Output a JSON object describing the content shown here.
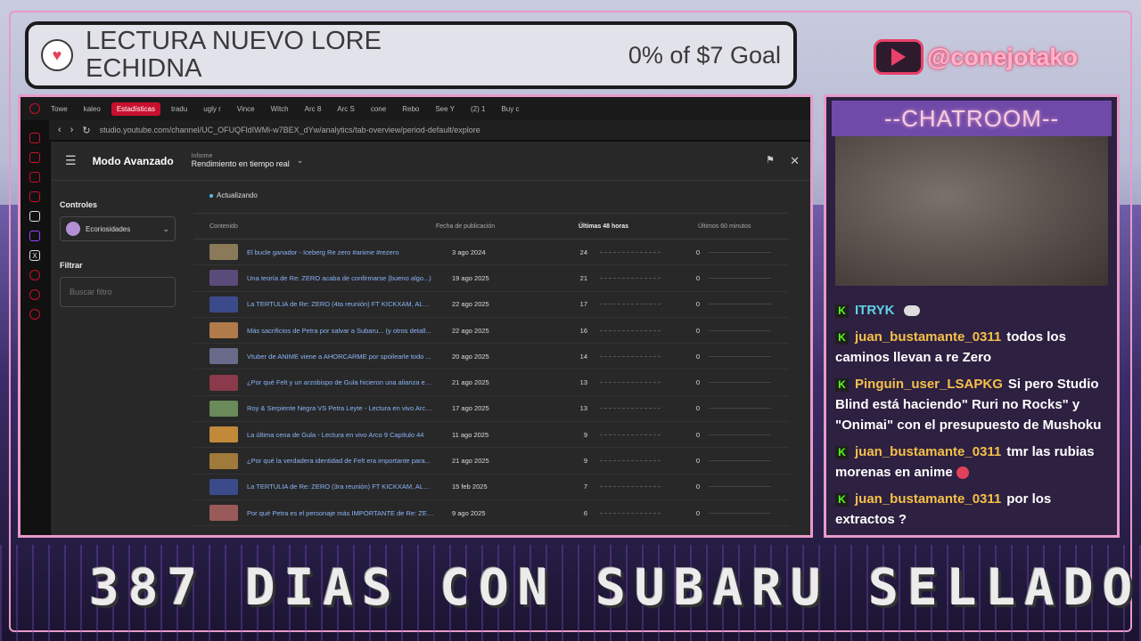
{
  "goal": {
    "title_line1": "LECTURA NUEVO LORE",
    "title_line2": "ECHIDNA",
    "progress_text": "0% of $7 Goal",
    "progress_fraction": 0
  },
  "social": {
    "youtube_handle": "@conejotako"
  },
  "browser": {
    "tabs": [
      "Towe",
      "kaleo",
      "Estadísticas",
      "tradu",
      "ugly r",
      "Vince",
      "Witch",
      "Arc 8",
      "Arc S",
      "cone",
      "Rebo",
      "See Y",
      "(2) 1",
      "Buy c"
    ],
    "active_tab_index": 2,
    "url": "studio.youtube.com/channel/UC_OFUQFldIWMi-w7BEX_dYw/analytics/tab-overview/period-default/explore"
  },
  "studio": {
    "mode_title": "Modo Avanzado",
    "report_label": "Informe",
    "report_value": "Rendimiento en tiempo real",
    "status": "Actualizando",
    "controls_heading": "Controles",
    "channel_name": "Ecoriosidades",
    "filter_heading": "Filtrar",
    "filter_placeholder": "Buscar filtro",
    "columns": {
      "content": "Contenido",
      "published": "Fecha de publicación",
      "last48": "Últimas 48 horas",
      "last60": "Últimos 60 minutos"
    },
    "rows": [
      {
        "title": "El bucle ganador - Iceberg Re zero #anime #rezero",
        "date": "3 ago 2024",
        "h48": "24",
        "m60": "0",
        "thumb": "#8a7a5a"
      },
      {
        "title": "Una teoría de Re: ZERO acaba de confirmarse (bueno algo...)",
        "date": "19 ago 2025",
        "h48": "21",
        "m60": "0",
        "thumb": "#5b4b7a"
      },
      {
        "title": "La TERTULIA de Re: ZERO (4ta reunión) FT KICKXAM, ALAN...",
        "date": "22 ago 2025",
        "h48": "17",
        "m60": "0",
        "thumb": "#3a4a8a"
      },
      {
        "title": "Más sacrificios de Petra por salvar a Subaru... (y otros detall...",
        "date": "22 ago 2025",
        "h48": "16",
        "m60": "0",
        "thumb": "#b07a4a"
      },
      {
        "title": "Vtuber de ANIME viene a AHORCARME por spoilearle todo ...",
        "date": "20 ago 2025",
        "h48": "14",
        "m60": "0",
        "thumb": "#6a6a8a"
      },
      {
        "title": "¿Por qué Felt y un arzobispo de Gula hicieron una alianza en...",
        "date": "21 ago 2025",
        "h48": "13",
        "m60": "0",
        "thumb": "#8a3a4a"
      },
      {
        "title": "Roy & Serpiente Negra VS Petra Leyte - Lectura en vivo Arco ...",
        "date": "17 ago 2025",
        "h48": "13",
        "m60": "0",
        "thumb": "#6a8a5a"
      },
      {
        "title": "La última cena de Gula - Lectura en vivo Arco 9 Capítulo 44",
        "date": "11 ago 2025",
        "h48": "9",
        "m60": "0",
        "thumb": "#c08a3a"
      },
      {
        "title": "¿Por qué la verdadera identidad de Felt era importante para...",
        "date": "21 ago 2025",
        "h48": "9",
        "m60": "0",
        "thumb": "#a07a3a"
      },
      {
        "title": "La TERTULIA de Re: ZERO (3ra reunión) FT KICKXAM, ALAN...",
        "date": "15 feb 2025",
        "h48": "7",
        "m60": "0",
        "thumb": "#3a4a8a"
      },
      {
        "title": "Por qué Petra es el personaje más IMPORTANTE de Re: ZER...",
        "date": "9 ago 2025",
        "h48": "6",
        "m60": "0",
        "thumb": "#9a5a5a"
      }
    ]
  },
  "chat": {
    "title": "--CHATROOM--",
    "messages": [
      {
        "user": "ITRYK",
        "text": "",
        "user_color": "#5fd3e6"
      },
      {
        "user": "juan_bustamante_0311",
        "text": "todos los caminos llevan a re Zero",
        "user_color": "#f5c04a"
      },
      {
        "user": "Pinguin_user_LSAPKG",
        "text": "Si pero Studio Blind está haciendo\" Ruri no Rocks\" y \"Onimai\" con el presupuesto de Mushoku",
        "user_color": "#f5c04a"
      },
      {
        "user": "juan_bustamante_0311",
        "text": "tmr las rubias morenas en anime",
        "user_color": "#f5c04a"
      },
      {
        "user": "juan_bustamante_0311",
        "text": "por los extractos ?",
        "user_color": "#f5c04a"
      }
    ]
  },
  "banner": {
    "text": "387 DIAS CON SUBARU SELLADO"
  }
}
